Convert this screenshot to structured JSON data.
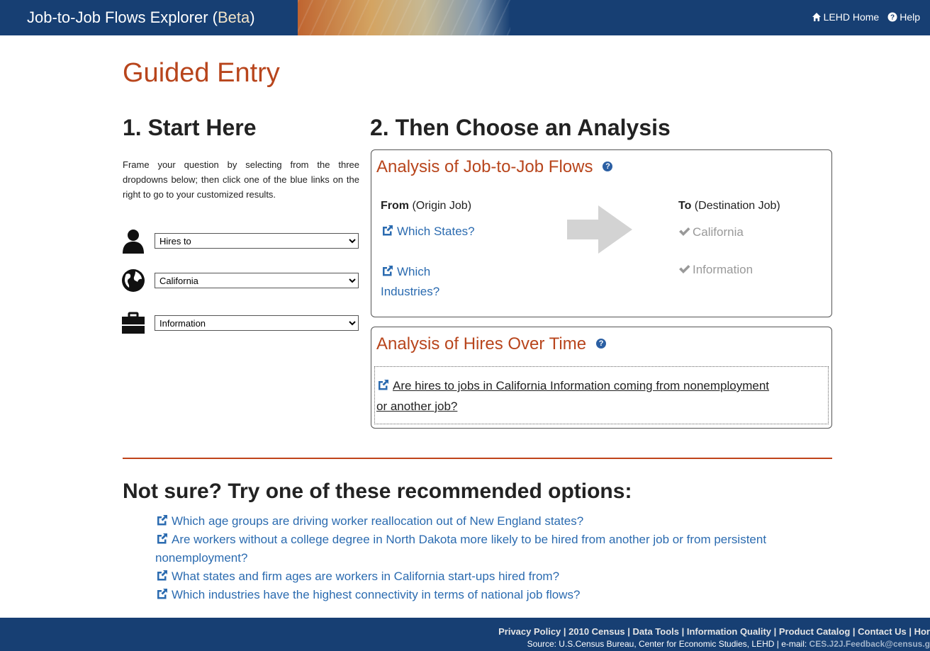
{
  "header": {
    "title": "Job-to-Job Flows Explorer (",
    "beta": "Beta",
    "title_close": ")",
    "home_link": "LEHD Home",
    "help_link": "Help"
  },
  "page_title": "Guided Entry",
  "start": {
    "heading": "1. Start Here",
    "intro": "Frame your question by selecting from the three dropdowns below; then click one of the blue links on the right to go to your customized results.",
    "dropdowns": [
      {
        "value": "Hires to",
        "icon": "person-icon"
      },
      {
        "value": "California",
        "icon": "globe-icon"
      },
      {
        "value": "Information",
        "icon": "briefcase-icon"
      }
    ]
  },
  "analysis": {
    "heading": "2. Then Choose an Analysis",
    "flows": {
      "title": "Analysis of Job-to-Job Flows",
      "from_label": "From",
      "from_sub": " (Origin Job)",
      "to_label": "To",
      "to_sub": " (Destination Job)",
      "links": [
        "Which States?",
        "Which Industries?"
      ],
      "destinations": [
        "California",
        "Information"
      ]
    },
    "hires": {
      "title": "Analysis of Hires Over Time",
      "link": "Are hires to jobs in California Information coming from nonemployment or another job?"
    }
  },
  "recommended": {
    "heading": "Not sure? Try one of these recommended options:",
    "items": [
      "Which age groups are driving worker reallocation out of New England states?",
      "Are workers without a college degree in North Dakota more likely to be hired from another job or from persistent nonemployment?",
      "What states and firm ages are workers in California start-ups hired from?",
      "Which industries have the highest connectivity in terms of national job flows?"
    ]
  },
  "footer": {
    "links": "Privacy Policy | 2010 Census | Data Tools | Information Quality | Product Catalog | Contact Us | Hor",
    "source": "Source: U.S.Census Bureau, Center for Economic Studies, LEHD   |   e-mail: ",
    "email": "CES.J2J.Feedback@census.g"
  },
  "colors": {
    "brand_navy": "#173f73",
    "accent_orange": "#b8451c",
    "link_blue": "#2b6bb0"
  }
}
